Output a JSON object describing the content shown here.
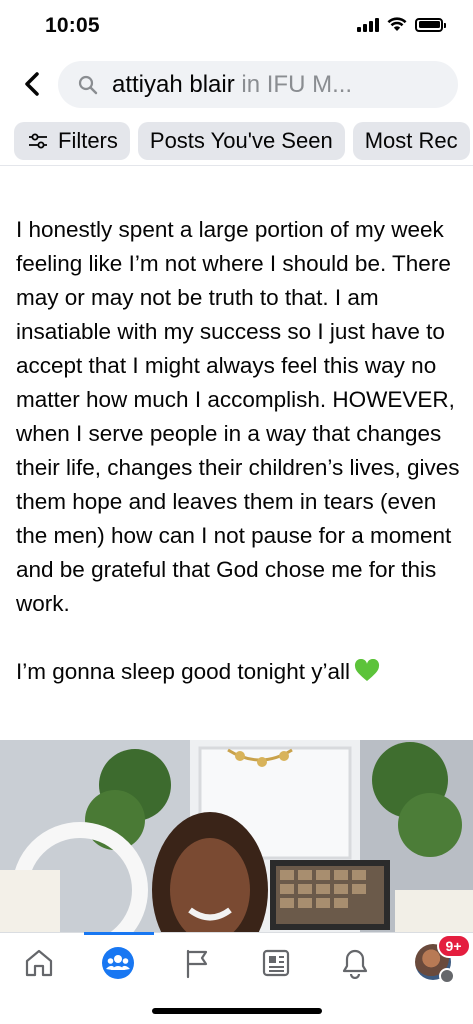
{
  "status_bar": {
    "time": "10:05"
  },
  "search": {
    "query": "attiyah blair",
    "scope": " in IFU M..."
  },
  "filters": {
    "chips": [
      "Filters",
      "Posts You've Seen",
      "Most Rec"
    ]
  },
  "post": {
    "paragraph1": "I honestly spent a large portion of my week feeling like I’m not where I should be. There may or may not be truth to that. I am insatiable with my success so I just have to accept that I might always feel this way no matter how much I accomplish. HOWEVER, when I serve people in a way that changes their life, changes their children’s lives, gives them hope and leaves them in tears (even the men) how can I not pause for a moment and be grateful that God chose me for this work.",
    "paragraph2": "I’m gonna sleep good tonight y’all",
    "emoji": "green-heart"
  },
  "tab_bar": {
    "active_tab": "groups",
    "notification_badge": "9+",
    "accent_color": "#1877f2"
  }
}
